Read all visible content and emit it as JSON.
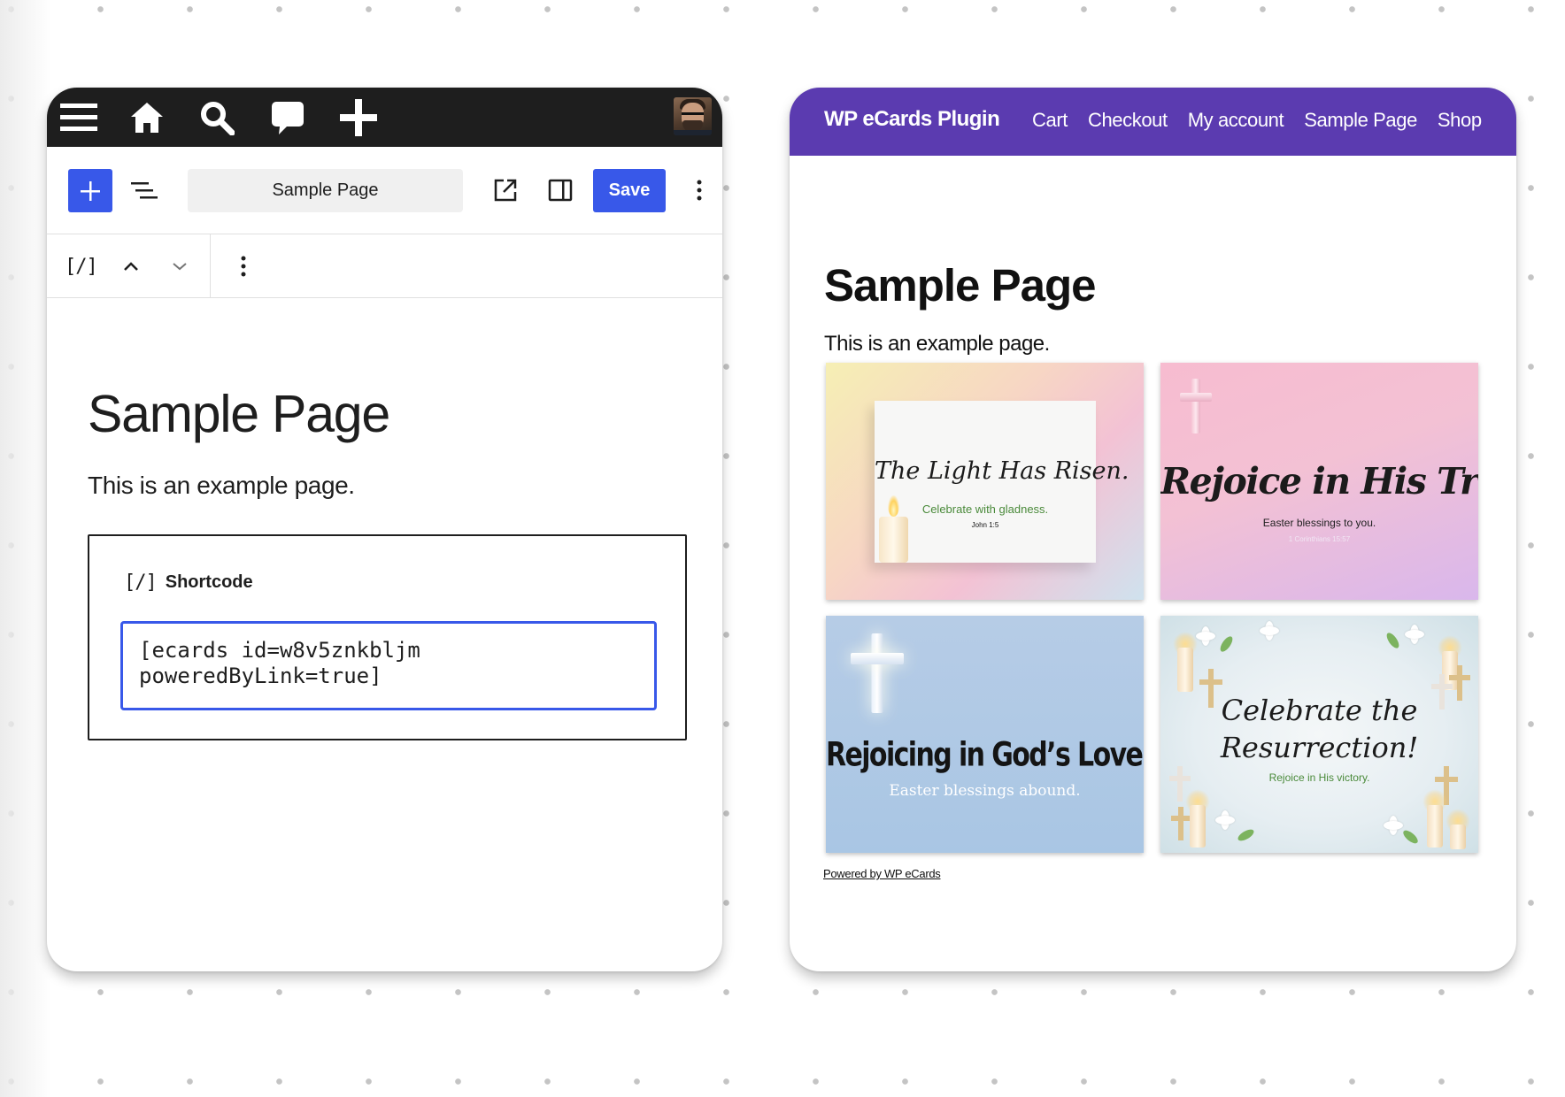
{
  "editor": {
    "adminbar": {
      "icons": [
        "menu-icon",
        "home-icon",
        "search-icon",
        "comment-icon",
        "plus-icon"
      ],
      "avatar": "user-avatar"
    },
    "toolbar": {
      "add_label": "+",
      "page_title": "Sample Page",
      "save_label": "Save"
    },
    "blockbar": {
      "block_glyph": "[/]"
    },
    "content": {
      "title": "Sample Page",
      "paragraph": "This is an example page."
    },
    "shortcode": {
      "glyph": "[/]",
      "label": "Shortcode",
      "value": "[ecards id=w8v5znkbljm\npoweredByLink=true]"
    },
    "colors": {
      "adminbar": "#1e1e1e",
      "accent": "#3858e9"
    }
  },
  "front": {
    "site_title": "WP eCards Plugin",
    "nav": [
      "Cart",
      "Checkout",
      "My account",
      "Sample Page",
      "Shop"
    ],
    "page_title": "Sample Page",
    "paragraph": "This is an example page.",
    "cards": [
      {
        "headline": "The Light Has Risen.",
        "subtext": "Celebrate with gladness.",
        "reference": "John 1:5"
      },
      {
        "headline": "Rejoice in His Triumph!",
        "subtext": "Easter blessings to you.",
        "reference": "1 Corinthians 15:57"
      },
      {
        "headline": "Rejoicing in God’s Love.",
        "subtext": "Easter blessings abound."
      },
      {
        "headline_line1": "Celebrate the",
        "headline_line2": "Resurrection!",
        "subtext": "Rejoice in His victory."
      }
    ],
    "powered_by": "Powered by WP eCards",
    "colors": {
      "header": "#5b3bb0"
    }
  }
}
